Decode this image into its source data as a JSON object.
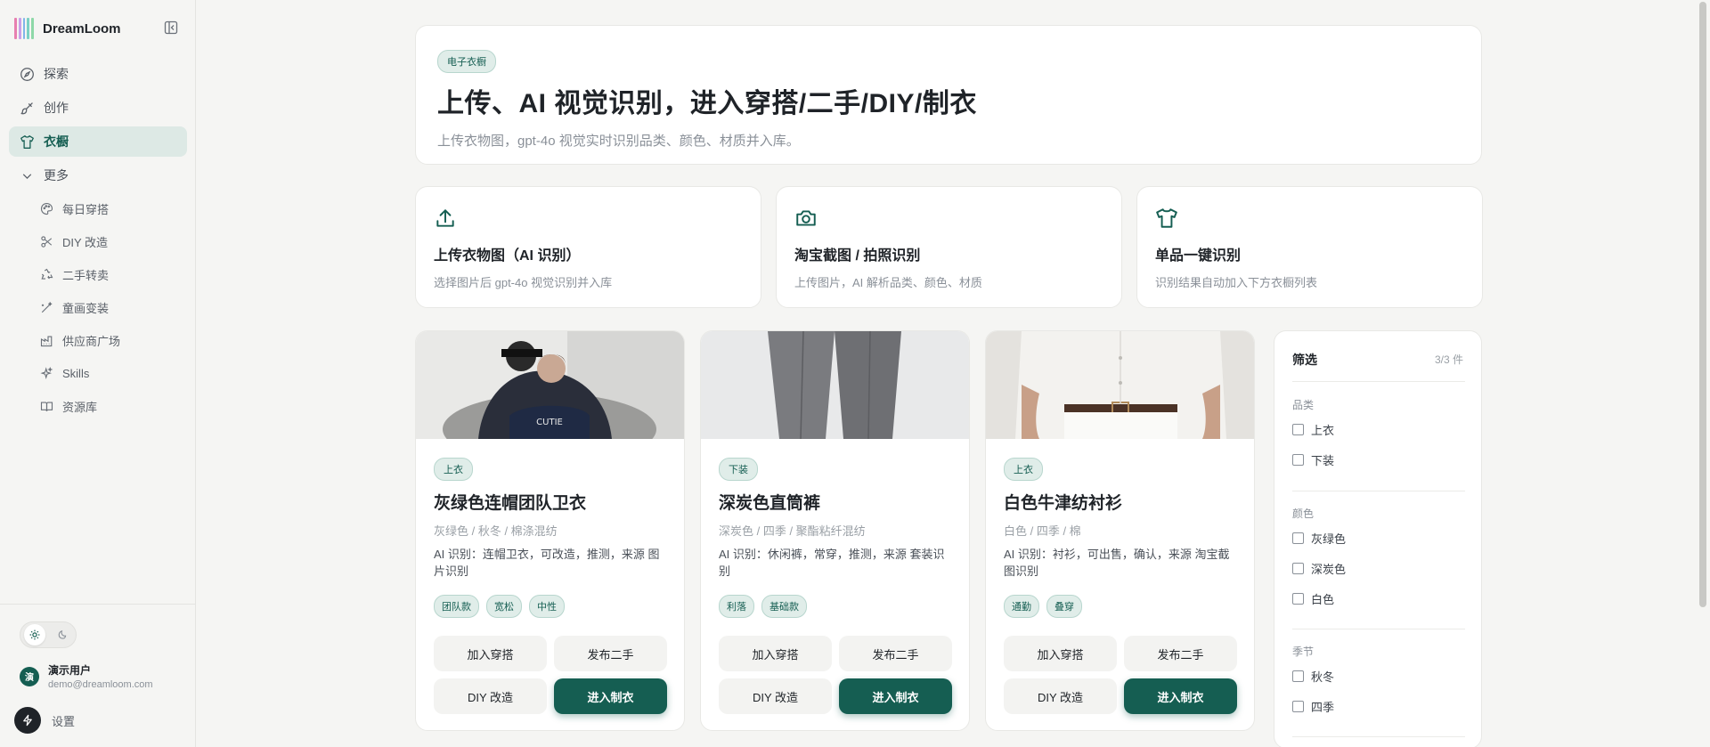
{
  "app": {
    "name": "DreamLoom"
  },
  "brand_colors": [
    "#e77fb0",
    "#c9a0e8",
    "#7fb5ea",
    "#7ad0c4",
    "#8ed8a8"
  ],
  "accent": "#155e52",
  "sidebar": {
    "items": [
      {
        "label": "探索",
        "icon": "compass-icon"
      },
      {
        "label": "创作",
        "icon": "brush-icon"
      },
      {
        "label": "衣橱",
        "icon": "shirt-icon",
        "active": true
      },
      {
        "label": "更多",
        "icon": "chevron-down-icon"
      }
    ],
    "sub_items": [
      {
        "label": "每日穿搭",
        "icon": "palette-icon"
      },
      {
        "label": "DIY 改造",
        "icon": "scissors-icon"
      },
      {
        "label": "二手转卖",
        "icon": "recycle-icon"
      },
      {
        "label": "童画变装",
        "icon": "magic-wand-icon"
      },
      {
        "label": "供应商广场",
        "icon": "factory-icon"
      },
      {
        "label": "Skills",
        "icon": "sparkle-icon"
      },
      {
        "label": "资源库",
        "icon": "book-icon"
      }
    ],
    "theme_active": "light"
  },
  "user": {
    "initial": "演",
    "name": "演示用户",
    "email": "demo@dreamloom.com"
  },
  "settings_label": "设置",
  "hero": {
    "badge": "电子衣橱",
    "title": "上传、AI 视觉识别，进入穿搭/二手/DIY/制衣",
    "subtitle": "上传衣物图，gpt-4o 视觉实时识别品类、颜色、材质并入库。"
  },
  "actions": [
    {
      "icon": "upload-icon",
      "title": "上传衣物图（AI 识别）",
      "desc": "选择图片后 gpt-4o 视觉识别并入库"
    },
    {
      "icon": "camera-icon",
      "title": "淘宝截图 / 拍照识别",
      "desc": "上传图片，AI 解析品类、颜色、材质"
    },
    {
      "icon": "shirt-icon",
      "title": "单品一键识别",
      "desc": "识别结果自动加入下方衣橱列表"
    }
  ],
  "items": [
    {
      "category": "上衣",
      "title": "灰绿色连帽团队卫衣",
      "meta": "灰绿色 / 秋冬 / 棉涤混纺",
      "ai": "AI 识别：连帽卫衣，可改造，推测，来源 图片识别",
      "tags": [
        "团队款",
        "宽松",
        "中性"
      ]
    },
    {
      "category": "下装",
      "title": "深炭色直筒裤",
      "meta": "深炭色 / 四季 / 聚酯粘纤混纺",
      "ai": "AI 识别：休闲裤，常穿，推测，来源 套装识别",
      "tags": [
        "利落",
        "基础款"
      ]
    },
    {
      "category": "上衣",
      "title": "白色牛津纺衬衫",
      "meta": "白色 / 四季 / 棉",
      "ai": "AI 识别：衬衫，可出售，确认，来源 淘宝截图识别",
      "tags": [
        "通勤",
        "叠穿"
      ]
    }
  ],
  "buttons": {
    "outfit": "加入穿搭",
    "resale": "发布二手",
    "diy": "DIY 改造",
    "tailor": "进入制衣"
  },
  "filter": {
    "title": "筛选",
    "count": "3/3 件",
    "groups": [
      {
        "label": "品类",
        "options": [
          "上衣",
          "下装"
        ]
      },
      {
        "label": "颜色",
        "options": [
          "灰绿色",
          "深炭色",
          "白色"
        ]
      },
      {
        "label": "季节",
        "options": [
          "秋冬",
          "四季"
        ]
      }
    ]
  }
}
